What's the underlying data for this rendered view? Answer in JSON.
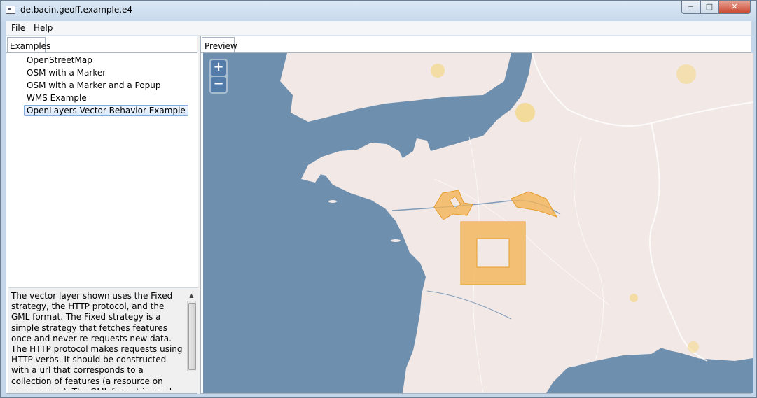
{
  "window": {
    "title": "de.bacin.geoff.example.e4",
    "controls": {
      "minimize": "─",
      "maximize": "□",
      "close": "✕"
    }
  },
  "menu": {
    "file": "File",
    "help": "Help"
  },
  "left_panel": {
    "tab": "Examples",
    "items": [
      {
        "label": "OpenStreetMap"
      },
      {
        "label": "OSM with a Marker"
      },
      {
        "label": "OSM with a Marker and a Popup"
      },
      {
        "label": "WMS Example"
      },
      {
        "label": "OpenLayers Vector Behavior Example"
      }
    ],
    "selected_index": 4,
    "description": "The vector layer shown uses the Fixed strategy, the HTTP protocol, and the GML format. The Fixed strategy is a simple strategy that fetches features once and never re-requests new data. The HTTP protocol makes requests using HTTP verbs.  It should be constructed with a url that corresponds to a collection of features (a resource on some server). The GML format is used to serialize"
  },
  "right_panel": {
    "tab": "Preview",
    "zoom_in": "+",
    "zoom_out": "−"
  },
  "colors": {
    "sea": "#6e8fad",
    "land": "#f2e8e6",
    "vector_fill": "#f2b457",
    "selection_border": "#84acdd"
  }
}
